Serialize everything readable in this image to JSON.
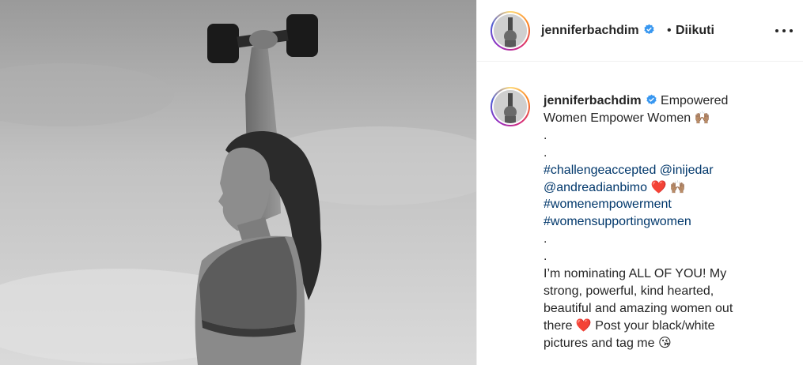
{
  "post": {
    "username": "jenniferbachdim",
    "follow_label": "Diikuti",
    "separator": "•",
    "more_icon": "more-horizontal-icon",
    "verified_icon": "verified-badge-icon"
  },
  "caption": {
    "username": "jenniferbachdim",
    "line1": "Empowered",
    "line2": "Women Empower Women",
    "dot1": ".",
    "dot2": ".",
    "tag1": "#challengeaccepted",
    "mention1": "@inijedar",
    "mention2": "@andreadianbimo",
    "tag2": "#womenempowerment",
    "tag3": "#womensupportingwomen",
    "dot3": ".",
    "dot4": ".",
    "body1": "I’m nominating ALL OF YOU! My",
    "body2": "strong, powerful, kind hearted,",
    "body3": "beautiful and amazing women out",
    "body4a": "there",
    "body4b": "Post your black/white",
    "body5": "pictures and tag me",
    "emoji_hands": "🙌🏽",
    "emoji_heart": "❤️",
    "emoji_wink": "😘"
  },
  "colors": {
    "link": "#00376b",
    "text": "#262626",
    "verified": "#3897f0",
    "heart": "#e0201b"
  }
}
